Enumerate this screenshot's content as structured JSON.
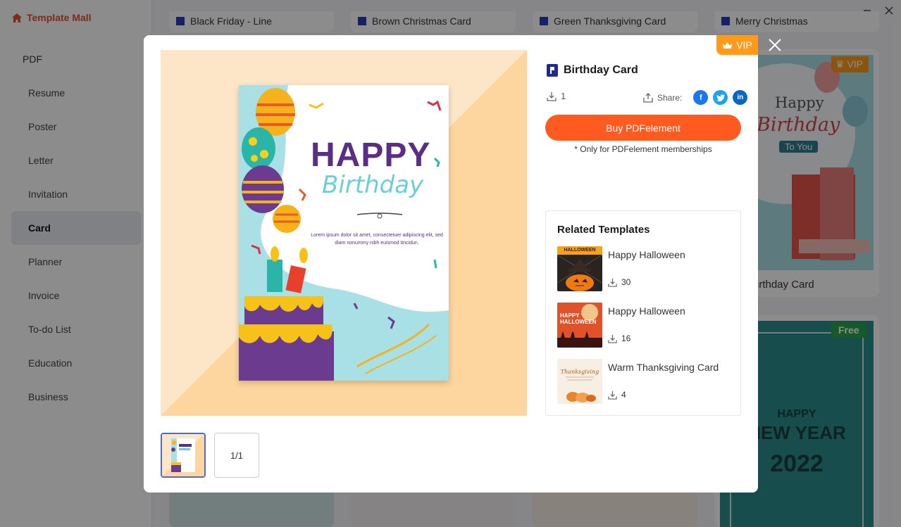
{
  "app": {
    "title": "Template Mall"
  },
  "sidebar": {
    "top_item": "PDF",
    "items": [
      {
        "label": "Resume"
      },
      {
        "label": "Poster"
      },
      {
        "label": "Letter"
      },
      {
        "label": "Invitation"
      },
      {
        "label": "Card",
        "active": true
      },
      {
        "label": "Planner"
      },
      {
        "label": "Invoice"
      },
      {
        "label": "To-do List"
      },
      {
        "label": "Education"
      },
      {
        "label": "Business"
      }
    ]
  },
  "background": {
    "top_titles": [
      "Black Friday - Line",
      "Brown Christmas Card",
      "Green Thanksgiving Card",
      "Merry Christmas"
    ],
    "right_card_1": {
      "badge": "VIP",
      "caption": "Birthday Card",
      "art_lines": [
        "Happy",
        "Birthday",
        "To You"
      ]
    },
    "right_card_2": {
      "badge": "Free",
      "art_lines": [
        "HAPPY",
        "NEW YEAR",
        "2022"
      ]
    }
  },
  "modal": {
    "vip_label": "VIP",
    "title": "Birthday Card",
    "downloads": "1",
    "share_label": "Share:",
    "buy_label": "Buy PDFelement",
    "membership_note": "* Only for PDFelement memberships",
    "page_indicator": "1/1",
    "preview": {
      "line1": "HAPPY",
      "line2": "Birthday",
      "body1": "Lorem ipsum dolor sit amet, consectetuer adipiscing elit, sed",
      "body2": "diam nonummy nibh euismod tincidun."
    },
    "related": {
      "heading": "Related Templates",
      "items": [
        {
          "name": "Happy Halloween",
          "downloads": "30",
          "thumb_text": "HALLOWEEN"
        },
        {
          "name": "Happy Halloween",
          "downloads": "16",
          "thumb_text": "HAPPY HALLOWEEN"
        },
        {
          "name": "Warm Thanksgiving Card",
          "downloads": "4",
          "thumb_text": "Thanksgiving"
        }
      ]
    }
  },
  "colors": {
    "accent": "#ff5a1f",
    "vip": "#ff9a1a",
    "brand": "#e0522a",
    "facebook": "#1877f2",
    "twitter": "#1da1f2",
    "linkedin": "#0a66c2"
  }
}
